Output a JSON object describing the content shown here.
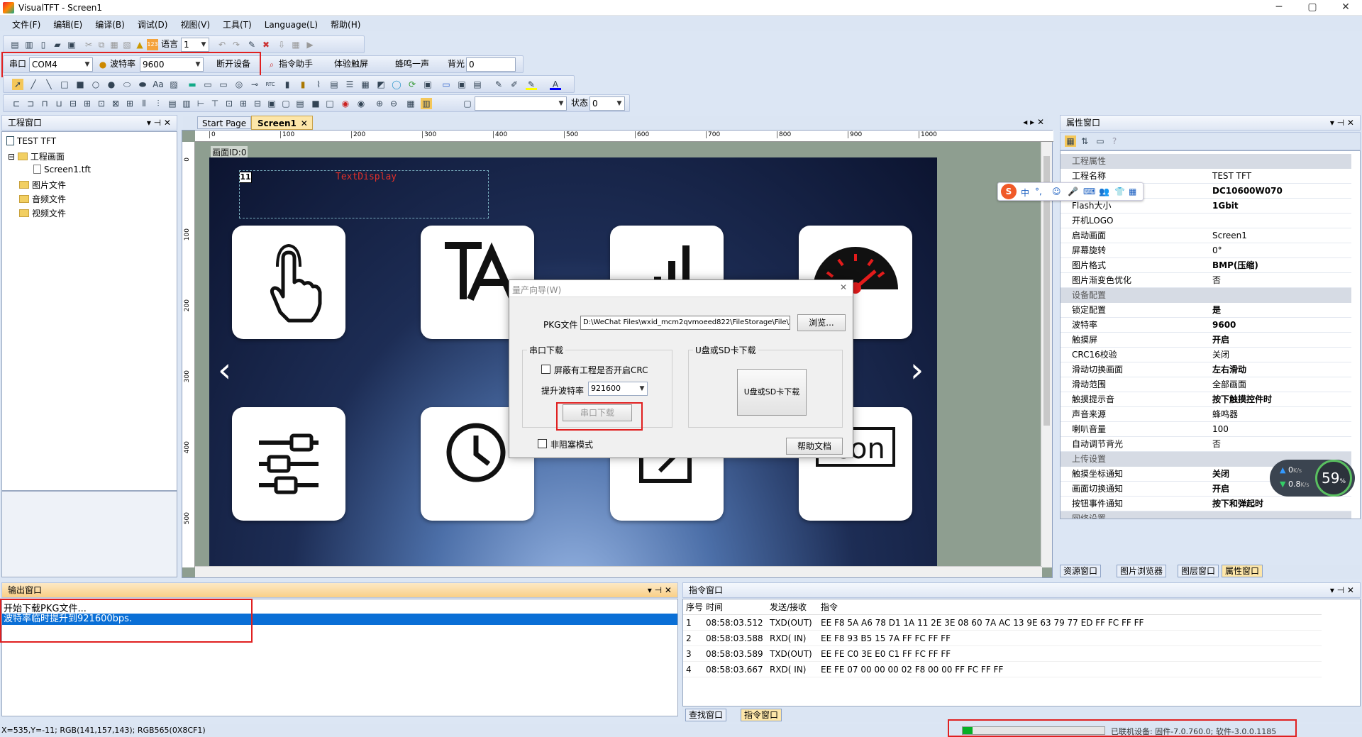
{
  "window": {
    "title": "VisualTFT - Screen1",
    "min": "─",
    "max": "▢",
    "close": "✕"
  },
  "menu": [
    "文件(F)",
    "编辑(E)",
    "编译(B)",
    "调试(D)",
    "视图(V)",
    "工具(T)",
    "Language(L)",
    "帮助(H)"
  ],
  "toolbar1": {
    "language_label": "语言",
    "language_value": "1"
  },
  "serialbar": {
    "port_label": "串口",
    "port_value": "COM4",
    "baud_label": "波特率",
    "baud_value": "9600",
    "disconnect": "断开设备",
    "cmd_helper": "指令助手",
    "experience": "体验触屏",
    "beep": "蜂鸣一声",
    "backlight_label": "背光",
    "backlight_value": "0"
  },
  "toolbar4": {
    "state_label": "状态",
    "state_value": "0"
  },
  "project_panel": {
    "title": "工程窗口",
    "tree": {
      "root": "TEST TFT",
      "screens": "工程画面",
      "screen1": "Screen1.tft",
      "images": "图片文件",
      "audio": "音频文件",
      "video": "视频文件"
    }
  },
  "editor": {
    "tabs": [
      "Start Page",
      "Screen1"
    ],
    "ruler_h": [
      "0",
      "100",
      "200",
      "300",
      "400",
      "500",
      "600",
      "700",
      "800",
      "900",
      "1000"
    ],
    "ruler_v": [
      "0",
      "100",
      "200",
      "300",
      "400",
      "500"
    ],
    "screen_id": "画面ID:0",
    "text_display": "TextDisplay",
    "ctrl_id": "11"
  },
  "dialog": {
    "title": "量产向导(W)",
    "pkg_label": "PKG文件",
    "pkg_path": "D:\\WeChat Files\\wxid_mcm2qvmoeed822\\FileStorage\\File\\20",
    "browse": "浏览...",
    "serial_group": "串口下载",
    "crc_label": "屏蔽有工程是否开启CRC",
    "raise_baud_label": "提升波特率",
    "raise_baud_value": "921600",
    "serial_download": "串口下载",
    "udisk_group": "U盘或SD卡下载",
    "udisk_download": "U盘或SD卡下载",
    "nonblocking": "非阻塞模式",
    "help_doc": "帮助文档"
  },
  "properties": {
    "title": "属性窗口",
    "sections": [
      {
        "name": "工程属性",
        "rows": [
          [
            "工程名称",
            "TEST TFT",
            false
          ],
          [
            "设备型号",
            "DC10600W070",
            true
          ],
          [
            "Flash大小",
            "1Gbit",
            true
          ],
          [
            "开机LOGO",
            "",
            false
          ],
          [
            "启动画面",
            "Screen1",
            false
          ],
          [
            "屏幕旋转",
            "0°",
            false
          ],
          [
            "图片格式",
            "BMP(压缩)",
            true
          ],
          [
            "图片渐变色优化",
            "否",
            false
          ]
        ]
      },
      {
        "name": "设备配置",
        "rows": [
          [
            "锁定配置",
            "是",
            true
          ],
          [
            "波特率",
            "9600",
            true
          ],
          [
            "触摸屏",
            "开启",
            true
          ],
          [
            "CRC16校验",
            "关闭",
            false
          ],
          [
            "滑动切换画面",
            "左右滑动",
            true
          ],
          [
            "滑动范围",
            "全部画面",
            false
          ],
          [
            "触摸提示音",
            "按下触摸控件时",
            true
          ],
          [
            "声音来源",
            "蜂鸣器",
            false
          ],
          [
            "喇叭音量",
            "100",
            false
          ],
          [
            "自动调节背光",
            "否",
            false
          ]
        ]
      },
      {
        "name": "上传设置",
        "rows": [
          [
            "触摸坐标通知",
            "关闭",
            true
          ],
          [
            "画面切换通知",
            "开启",
            true
          ],
          [
            "按钮事件通知",
            "按下和弹起时",
            true
          ]
        ]
      },
      {
        "name": "网络设置",
        "rows": []
      }
    ],
    "bottom_tabs": [
      "资源窗口",
      "图片浏览器",
      "图层窗口",
      "属性窗口"
    ]
  },
  "ime": {
    "cn": "中",
    "punct": "°,",
    "items": [
      "☺",
      "🎤",
      "⌨",
      "👥",
      "👕",
      "▦"
    ]
  },
  "netmon": {
    "up": "0",
    "up_unit": "K/s",
    "down": "0.8",
    "down_unit": "K/s",
    "cpu": "59",
    "cpu_unit": "%"
  },
  "output": {
    "title": "输出窗口",
    "lines": [
      "开始下载PKG文件...",
      "波特率临时提升到921600bps."
    ]
  },
  "command": {
    "title": "指令窗口",
    "headers": [
      "序号",
      "时间",
      "发送/接收",
      "指令"
    ],
    "rows": [
      [
        "1",
        "08:58:03.512",
        "TXD(OUT)",
        "EE F8 5A A6 78 D1 1A 11 2E 3E 08 60 7A AC 13 9E 63 79 77 ED FF FC FF FF"
      ],
      [
        "2",
        "08:58:03.588",
        "RXD( IN)",
        "EE F8 93 B5 15 7A FF FC FF FF"
      ],
      [
        "3",
        "08:58:03.589",
        "TXD(OUT)",
        "EE FE C0 3E E0 C1 FF FC FF FF"
      ],
      [
        "4",
        "08:58:03.667",
        "RXD( IN)",
        "EE FE 07 00 00 00 02 F8 00 00 FF FC FF FF"
      ]
    ],
    "tabs": [
      "查找窗口",
      "指令窗口"
    ]
  },
  "status": {
    "coords": "X=535,Y=-11; RGB(141,157,143); RGB565(0X8CF1)",
    "progress": 0.07,
    "device": "已联机设备: 固件-7.0.760.0; 软件-3.0.0.1185"
  }
}
